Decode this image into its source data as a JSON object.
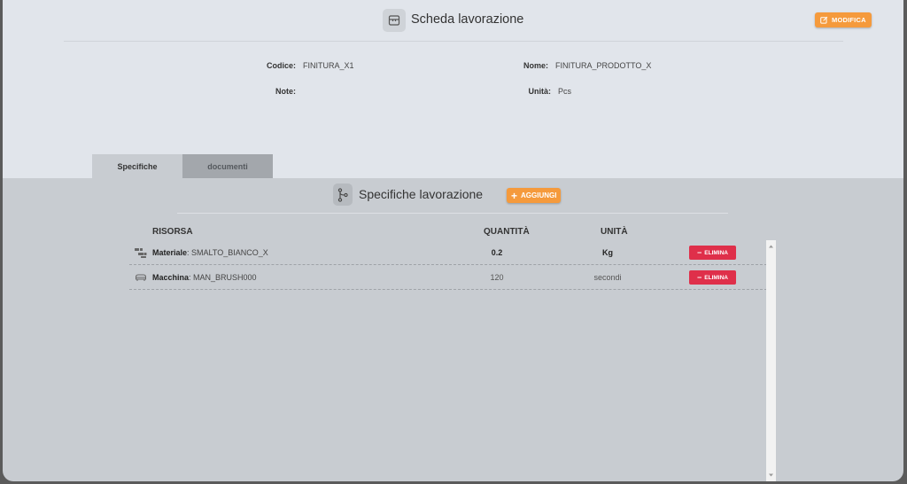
{
  "header": {
    "title": "Scheda lavorazione",
    "edit_label": "MODIFICA"
  },
  "details": {
    "codice_label": "Codice:",
    "codice_value": "FINITURA_X1",
    "nome_label": "Nome:",
    "nome_value": "FINITURA_PRODOTTO_X",
    "note_label": "Note:",
    "note_value": "",
    "unita_label": "Unità:",
    "unita_value": "Pcs"
  },
  "tabs": [
    {
      "label": "Specifiche",
      "active": true
    },
    {
      "label": "documenti",
      "active": false
    }
  ],
  "specs": {
    "title": "Specifiche lavorazione",
    "add_label": "AGGIUNGI",
    "columns": {
      "risorsa": "RISORSA",
      "quantita": "QUANTITÀ",
      "unita": "UNITÀ"
    },
    "rows": [
      {
        "icon": "material-icon",
        "type": "Materiale",
        "name": ": SMALTO_BIANCO_X",
        "quantity": "0.2",
        "unit": "Kg",
        "delete_label": "ELIMINA"
      },
      {
        "icon": "machine-icon",
        "type": "Macchina",
        "name": ": MAN_BRUSH000",
        "quantity": "120",
        "unit": "secondi",
        "delete_label": "ELIMINA"
      }
    ]
  },
  "colors": {
    "accent": "#f59a3c",
    "danger": "#df2f4a",
    "top_panel": "#e1e5eb",
    "content_bg": "#c8ccd1"
  }
}
